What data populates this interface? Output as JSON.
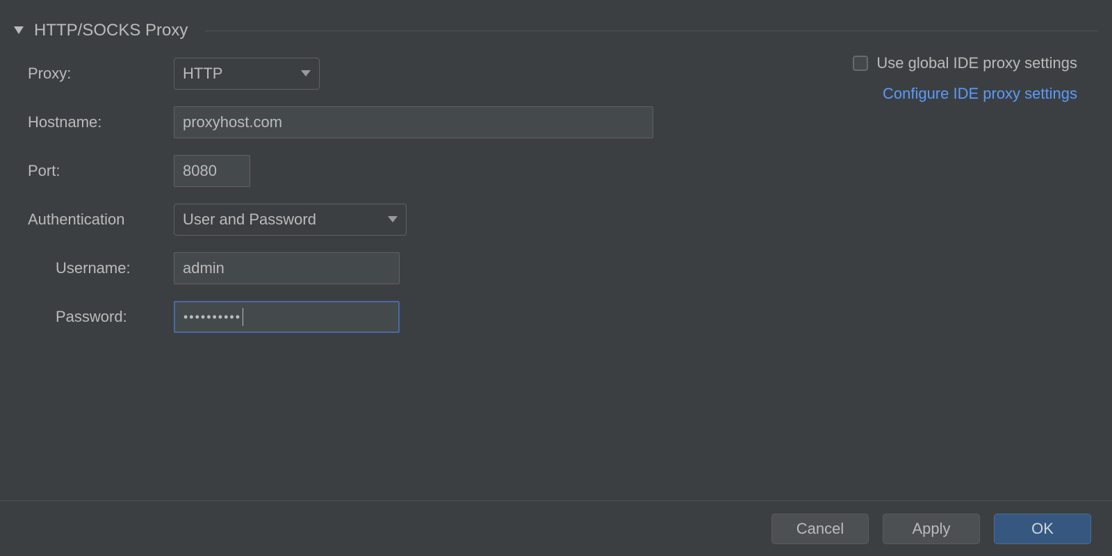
{
  "section": {
    "title": "HTTP/SOCKS Proxy"
  },
  "topRight": {
    "useGlobal": "Use global IDE proxy settings",
    "configureLink": "Configure IDE proxy settings"
  },
  "labels": {
    "proxy": "Proxy:",
    "hostname": "Hostname:",
    "port": "Port:",
    "authentication": "Authentication",
    "username": "Username:",
    "password": "Password:"
  },
  "values": {
    "proxyType": "HTTP",
    "hostname": "proxyhost.com",
    "port": "8080",
    "authMode": "User and Password",
    "username": "admin",
    "passwordMasked": "••••••••••"
  },
  "buttons": {
    "cancel": "Cancel",
    "apply": "Apply",
    "ok": "OK"
  }
}
